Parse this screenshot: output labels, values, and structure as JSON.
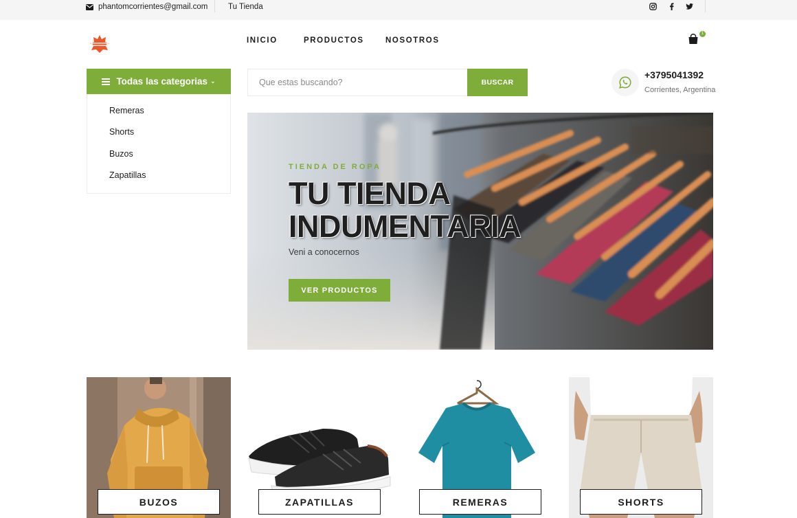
{
  "topbar": {
    "email": "phantomcorrientes@gmail.com",
    "store_label": "Tu Tienda",
    "social": [
      "instagram-icon",
      "facebook-icon",
      "twitter-icon"
    ]
  },
  "header": {
    "logo": "phantom-logo",
    "nav": [
      "INICIO",
      "PRODUCTOS",
      "NOSOTROS"
    ],
    "cart_count": "1"
  },
  "sidebar": {
    "title": "Todas las categorias",
    "items": [
      "Remeras",
      "Shorts",
      "Buzos",
      "Zapatillas"
    ]
  },
  "search": {
    "placeholder": "Que estas buscando?",
    "button": "BUSCAR"
  },
  "contact": {
    "phone": "+3795041392",
    "location": "Corrientes, Argentina"
  },
  "hero": {
    "tag": "TIENDA DE ROPA",
    "title_line1": "TU TIENDA",
    "title_line2": "INDUMENTARIA",
    "subtitle": "Veni a conocernos",
    "button": "VER PRODUCTOS"
  },
  "categories": [
    {
      "label": "BUZOS"
    },
    {
      "label": "ZAPATILLAS"
    },
    {
      "label": "REMERAS"
    },
    {
      "label": "SHORTS"
    }
  ],
  "colors": {
    "accent": "#7fad39",
    "dark": "#1c1c1c",
    "topbar_bg": "#f5f5f5"
  }
}
